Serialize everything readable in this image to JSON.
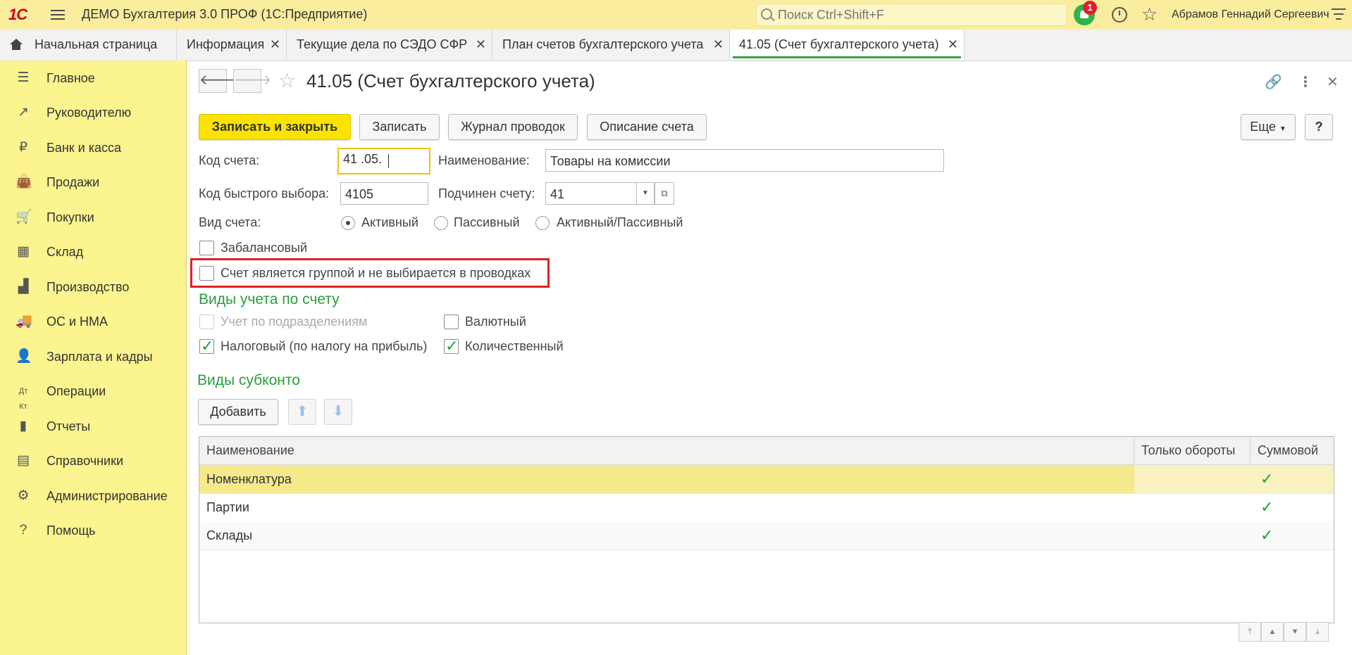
{
  "app": {
    "title": "ДЕМО Бухгалтерия 3.0 ПРОФ  (1С:Предприятие)",
    "logo": "1С",
    "search_placeholder": "Поиск Ctrl+Shift+F",
    "notifications_count": "1",
    "user": "Абрамов Геннадий Сергеевич"
  },
  "tabs": [
    {
      "label": "Начальная страница"
    },
    {
      "label": "Информация"
    },
    {
      "label": "Текущие дела по СЭДО СФР"
    },
    {
      "label": "План счетов бухгалтерского учета"
    },
    {
      "label": "41.05 (Счет бухгалтерского учета)"
    }
  ],
  "sidebar": {
    "items": [
      {
        "label": "Главное",
        "icon": "menu-icon"
      },
      {
        "label": "Руководителю",
        "icon": "trend-icon"
      },
      {
        "label": "Банк и касса",
        "icon": "coin-icon"
      },
      {
        "label": "Продажи",
        "icon": "bag-icon"
      },
      {
        "label": "Покупки",
        "icon": "cart-icon"
      },
      {
        "label": "Склад",
        "icon": "warehouse-icon"
      },
      {
        "label": "Производство",
        "icon": "factory-icon"
      },
      {
        "label": "ОС и НМА",
        "icon": "truck-icon"
      },
      {
        "label": "Зарплата и кадры",
        "icon": "person-icon"
      },
      {
        "label": "Операции",
        "icon": "dt-kt-icon"
      },
      {
        "label": "Отчеты",
        "icon": "bar-chart-icon"
      },
      {
        "label": "Справочники",
        "icon": "books-icon"
      },
      {
        "label": "Администрирование",
        "icon": "gear-icon"
      },
      {
        "label": "Помощь",
        "icon": "question-icon"
      }
    ]
  },
  "form": {
    "title": "41.05 (Счет бухгалтерского учета)",
    "buttons": {
      "save_close": "Записать и закрыть",
      "save": "Записать",
      "journal": "Журнал проводок",
      "description": "Описание счета",
      "more": "Еще",
      "help": "?"
    },
    "code_label": "Код счета:",
    "code_value": "41 .05.",
    "name_label": "Наименование:",
    "name_value": "Товары на комиссии",
    "quick_code_label": "Код быстрого выбора:",
    "quick_code_value": "4105",
    "parent_label": "Подчинен счету:",
    "parent_value": "41",
    "type_label": "Вид счета:",
    "type_options": [
      "Активный",
      "Пассивный",
      "Активный/Пассивный"
    ],
    "type_selected": "Активный",
    "offbalance_label": "Забалансовый",
    "offbalance_checked": false,
    "group_label": "Счет является группой и не выбирается в проводках",
    "group_checked": false,
    "accounting_section": "Виды учета по счету",
    "dept_label": "Учет по подразделениям",
    "dept_checked": false,
    "currency_label": "Валютный",
    "currency_checked": false,
    "tax_label": "Налоговый (по налогу на прибыль)",
    "tax_checked": true,
    "quantity_label": "Количественный",
    "quantity_checked": true,
    "subconto_section": "Виды субконто",
    "add_button": "Добавить"
  },
  "table": {
    "columns": [
      "Наименование",
      "Только обороты",
      "Суммовой"
    ],
    "rows": [
      {
        "name": "Номенклатура",
        "turnover_only": false,
        "sum": true,
        "selected": true
      },
      {
        "name": "Партии",
        "turnover_only": false,
        "sum": true,
        "selected": false
      },
      {
        "name": "Склады",
        "turnover_only": false,
        "sum": true,
        "selected": false
      }
    ]
  },
  "colors": {
    "topbar": "#fbed9e",
    "sidebar": "#fbf48f",
    "primary_button": "#fce300",
    "section_heading": "#2a9d3a",
    "highlight_box": "#e02020",
    "check": "#1e9e3a"
  }
}
